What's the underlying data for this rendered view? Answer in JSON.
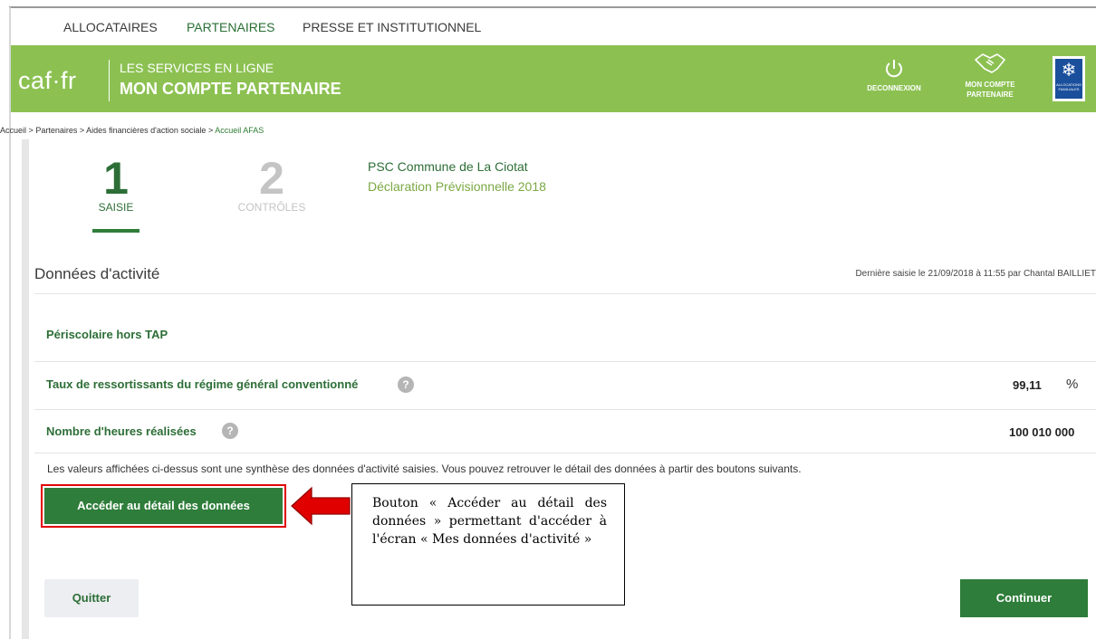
{
  "topnav": {
    "items": [
      "ALLOCATAIRES",
      "PARTENAIRES",
      "PRESSE ET INSTITUTIONNEL"
    ],
    "active_index": 1
  },
  "header": {
    "logo": "caf·fr",
    "services_line1": "LES SERVICES EN LIGNE",
    "services_line2": "MON COMPTE PARTENAIRE",
    "logout_label": "DECONNEXION",
    "account_label_line1": "MON COMPTE",
    "account_label_line2": "PARTENAIRE",
    "flag_text": "ALLOCATIONS FAMILIALES",
    "color": "#8cc152"
  },
  "breadcrumb": {
    "items": [
      "Accueil",
      "Partenaires",
      "Aides financières d'action sociale"
    ],
    "separator": ">",
    "current": "Accueil AFAS"
  },
  "steps": [
    {
      "number": "1",
      "label": "SAISIE",
      "active": true
    },
    {
      "number": "2",
      "label": "CONTRÔLES",
      "active": false
    }
  ],
  "context": {
    "partner": "PSC Commune de La Ciotat",
    "declaration": "Déclaration Prévisionnelle 2018"
  },
  "section": {
    "title": "Données d'activité",
    "last_saisie": "Dernière saisie le 21/09/2018 à 11:55 par Chantal BAILLIET"
  },
  "activity": {
    "name": "Périscolaire hors TAP",
    "rows": [
      {
        "label": "Taux de ressortissants du régime général conventionné",
        "value": "99,11",
        "unit": "%"
      },
      {
        "label": "Nombre d'heures réalisées",
        "value": "100 010 000",
        "unit": ""
      }
    ]
  },
  "info_text": "Les valeurs affichées ci-dessus sont une synthèse des données d'activité saisies. Vous pouvez retrouver le détail des données à partir des boutons suivants.",
  "buttons": {
    "detail": "Accéder au détail des données",
    "quit": "Quitter",
    "continue": "Continuer"
  },
  "callout": {
    "text": "Bouton « Accéder au détail des données » permettant d'accéder à l'écran « Mes données d'activité »"
  },
  "colors": {
    "primary_green": "#2e7d3a",
    "highlight_red": "#e00000"
  }
}
